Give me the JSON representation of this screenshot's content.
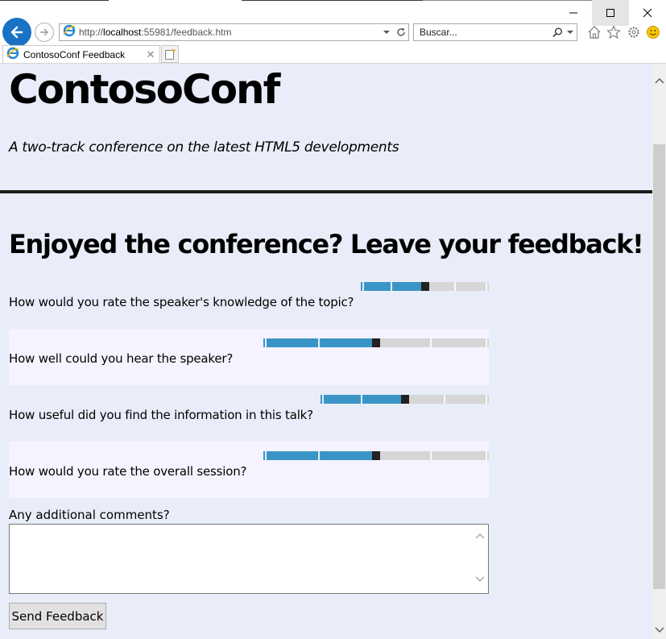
{
  "browser": {
    "url_prefix": "http://",
    "url_host": "localhost",
    "url_rest": ":55981/feedback.htm",
    "search_placeholder": "Buscar...",
    "tab_title": "ContosoConf Feedback",
    "accent_color": "#1a72c4"
  },
  "page": {
    "site_title": "ContosoConf",
    "site_subtitle": "A two-track conference on the latest HTML5 developments",
    "heading": "Enjoyed the conference? Leave your feedback!",
    "questions": [
      {
        "label": "How would you rate the speaker's knowledge of the topic?",
        "rating_fraction": 0.5
      },
      {
        "label": "How well could you hear the speaker?",
        "rating_fraction": 0.5
      },
      {
        "label": "How useful did you find the information in this talk?",
        "rating_fraction": 0.5
      },
      {
        "label": "How would you rate the overall session?",
        "rating_fraction": 0.5
      }
    ],
    "comments_label": "Any additional comments?",
    "comments_value": "",
    "submit_label": "Send Feedback",
    "slider_fill_color": "#3a95c6",
    "background_color": "#e9edf9"
  }
}
